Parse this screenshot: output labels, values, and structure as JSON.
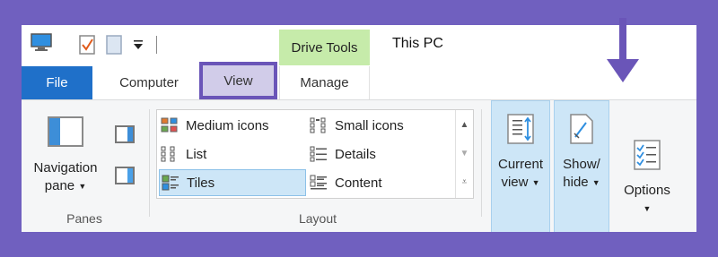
{
  "title_bar": {
    "context_tab": "Drive Tools",
    "window_title": "This PC"
  },
  "tabs": [
    {
      "label": "File"
    },
    {
      "label": "Computer"
    },
    {
      "label": "View"
    },
    {
      "label": "Manage"
    }
  ],
  "panes_group": {
    "nav_pane_label_1": "Navigation",
    "nav_pane_label_2": "pane",
    "group_label": "Panes"
  },
  "layout_group": {
    "items": [
      {
        "label": "Medium icons"
      },
      {
        "label": "Small icons"
      },
      {
        "label": "List"
      },
      {
        "label": "Details"
      },
      {
        "label": "Tiles"
      },
      {
        "label": "Content"
      }
    ],
    "selected": "Tiles",
    "group_label": "Layout"
  },
  "current_view": {
    "label_1": "Current",
    "label_2": "view"
  },
  "show_hide": {
    "label_1": "Show/",
    "label_2": "hide"
  },
  "options": {
    "label": "Options"
  },
  "colors": {
    "background": "#7060bf",
    "file_tab": "#1f70c9",
    "context_tab": "#c6ebaa",
    "highlight": "#6a55b8",
    "selection": "#cde6f7"
  }
}
